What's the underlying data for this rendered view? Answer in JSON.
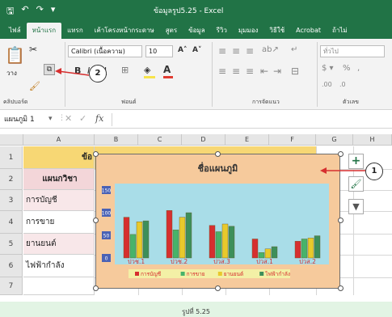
{
  "window": {
    "title": "ข้อมูลรูป5.25 - Excel"
  },
  "ribbon_tabs": [
    "ไฟล์",
    "หน้าแรก",
    "แทรก",
    "เค้าโครงหน้ากระดาษ",
    "สูตร",
    "ข้อมูล",
    "รีวิว",
    "มุมมอง",
    "วิธีใช้",
    "Acrobat",
    "ถ้าไม่"
  ],
  "ribbon": {
    "paste_label": "วาง",
    "font_name": "Calibri (เนื้อความ)",
    "font_size": "10",
    "number_format": "ทั่วไป",
    "group_clipboard": "คลิปบอร์ด",
    "group_font": "ฟอนต์",
    "group_alignment": "การจัดแนว",
    "group_number": "ตัวเลข"
  },
  "callouts": {
    "one": "1",
    "two": "2"
  },
  "formula_bar": {
    "name_box": "แผนภูมิ 1",
    "fx": "fx"
  },
  "columns": [
    "A",
    "B",
    "C",
    "D",
    "E",
    "F",
    "G",
    "H"
  ],
  "rows": [
    "1",
    "2",
    "3",
    "4",
    "5",
    "6",
    "7"
  ],
  "cells": {
    "a1": "ข้อ",
    "a2": "แผนกวิชา",
    "a3": "การบัญชี",
    "a4": "การขาย",
    "a5": "ยานยนต์",
    "a6": "ไฟฟ้ากำลัง"
  },
  "caption": "รูปที่ 5.25",
  "colors": {
    "excel_green": "#217346",
    "chart_bg": "#f6ca9c",
    "plot_bg": "#a9dde8",
    "header_fill": "#f7d774"
  },
  "chart_data": {
    "type": "bar",
    "title": "ชื่อแผนภูมิ",
    "categories": [
      "ปวช.1",
      "ปวช.2",
      "ปวส.3",
      "ปวส.1",
      "ปวส.2"
    ],
    "y_tick_labels": [
      "150",
      "100",
      "50",
      "0"
    ],
    "ylim": [
      0,
      150
    ],
    "grid": false,
    "legend_position": "bottom",
    "series": [
      {
        "name": "การบัญชี",
        "color": "#d62f2f",
        "values": [
          90,
          105,
          72,
          42,
          37
        ]
      },
      {
        "name": "การขาย",
        "color": "#47b36a",
        "values": [
          52,
          62,
          58,
          12,
          42
        ]
      },
      {
        "name": "ยานยนต์",
        "color": "#e8c92c",
        "values": [
          80,
          90,
          75,
          20,
          44
        ]
      },
      {
        "name": "ไฟฟ้ากำลัง",
        "color": "#3d8f5a",
        "values": [
          82,
          100,
          70,
          25,
          49
        ]
      }
    ]
  }
}
